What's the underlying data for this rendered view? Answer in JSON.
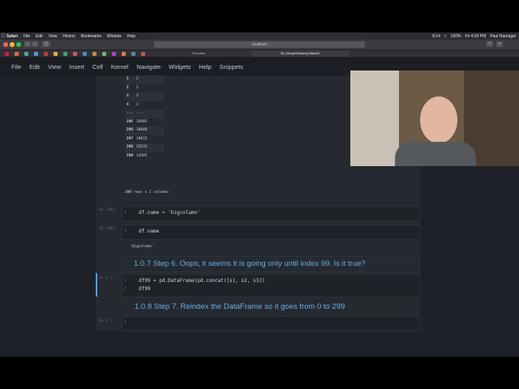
{
  "menubar": {
    "items": [
      "Safari",
      "File",
      "Edit",
      "View",
      "History",
      "Bookmarks",
      "Window",
      "Help"
    ],
    "status": [
      "8:14",
      "100%",
      "Fri 4:33 PM",
      "Paul Harnagel"
    ]
  },
  "safari": {
    "url": "localhost",
    "tabs": [
      "Favorites",
      "08_Merge/Housing Market/"
    ]
  },
  "jupyter_menu": [
    "File",
    "Edit",
    "View",
    "Insert",
    "Cell",
    "Kernel",
    "Navigate",
    "Widgets",
    "Help",
    "Snippets"
  ],
  "dataframe": {
    "rows": [
      {
        "idx": "1",
        "val": "2"
      },
      {
        "idx": "2",
        "val": "2"
      },
      {
        "idx": "3",
        "val": "3"
      },
      {
        "idx": "4",
        "val": "3"
      },
      {
        "idx": "...",
        "val": "..."
      },
      {
        "idx": "295",
        "val": "26905"
      },
      {
        "idx": "296",
        "val": "18948"
      },
      {
        "idx": "297",
        "val": "18922"
      },
      {
        "idx": "298",
        "val": "25632"
      },
      {
        "idx": "299",
        "val": "14585"
      }
    ],
    "shape": "300 rows × 1 columns"
  },
  "cells": {
    "c1": {
      "prompt": "In [19]:",
      "code": "df.name = 'bigcolumn'"
    },
    "c2": {
      "prompt": "In [20]:",
      "code": "df.name",
      "output": "'bigcolumn'"
    },
    "h1": "1.0.7  Step 6. Oops, it seems it is going only until index 99. Is it true?",
    "c3": {
      "prompt": "In [ ]:",
      "line1": "df99 = pd.DataFrame(pd.concat([s1, s2, s3])",
      "line2": "df99"
    },
    "h2": "1.0.8  Step 7. Reindex the DataFrame so it goes from 0 to 299",
    "c4": {
      "prompt": "In [ ]:"
    }
  },
  "dock_icons": [
    "finder-icon",
    "siri-icon",
    "launchpad-icon",
    "safari-icon",
    "chrome-icon",
    "brave-icon",
    "preview-icon",
    "calendar-icon",
    "notes-icon",
    "photos-icon",
    "messages-icon",
    "appletv-icon",
    "appstore-icon",
    "word-icon",
    "excel-icon",
    "puzzle-icon",
    "grammarly-icon",
    "teams-icon",
    "terminal-icon",
    "script-icon",
    "vscode-icon",
    "progress-icon",
    "chrome-canary-icon",
    "h-app-icon",
    "keychain-icon",
    "teamviewer-icon",
    "trash-icon"
  ],
  "dock_labels": {
    "calendar-icon": "14",
    "appletv-icon": "tv",
    "word-icon": "W",
    "excel-icon": "X",
    "teams-icon": "T",
    "h-app-icon": "H"
  },
  "colors": {
    "accent": "#5fb0e8",
    "notebook_bg": "#262a30"
  }
}
